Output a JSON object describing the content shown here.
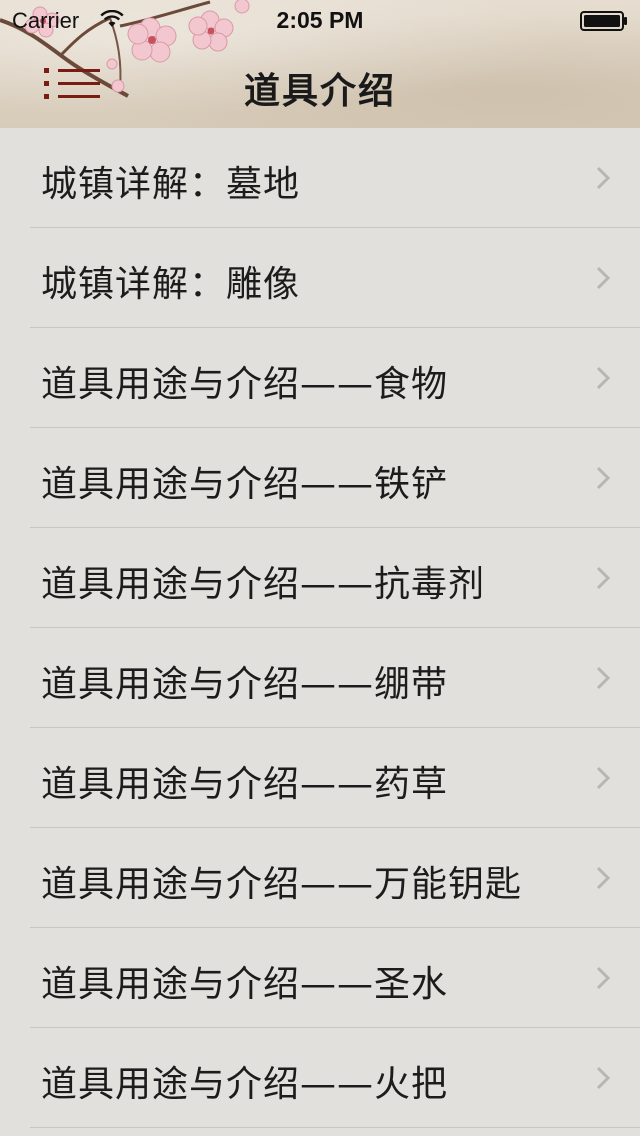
{
  "status_bar": {
    "carrier": "Carrier",
    "time": "2:05 PM"
  },
  "nav": {
    "title": "道具介绍",
    "menu_icon": "list-menu-icon",
    "accent_color": "#7a1c14"
  },
  "list": {
    "items": [
      {
        "label": "城镇详解：墓地"
      },
      {
        "label": "城镇详解：雕像"
      },
      {
        "label": "道具用途与介绍——食物"
      },
      {
        "label": "道具用途与介绍——铁铲"
      },
      {
        "label": "道具用途与介绍——抗毒剂"
      },
      {
        "label": "道具用途与介绍——绷带"
      },
      {
        "label": "道具用途与介绍——药草"
      },
      {
        "label": "道具用途与介绍——万能钥匙"
      },
      {
        "label": "道具用途与介绍——圣水"
      },
      {
        "label": "道具用途与介绍——火把"
      }
    ],
    "chevron_icon": "chevron-right-icon"
  }
}
